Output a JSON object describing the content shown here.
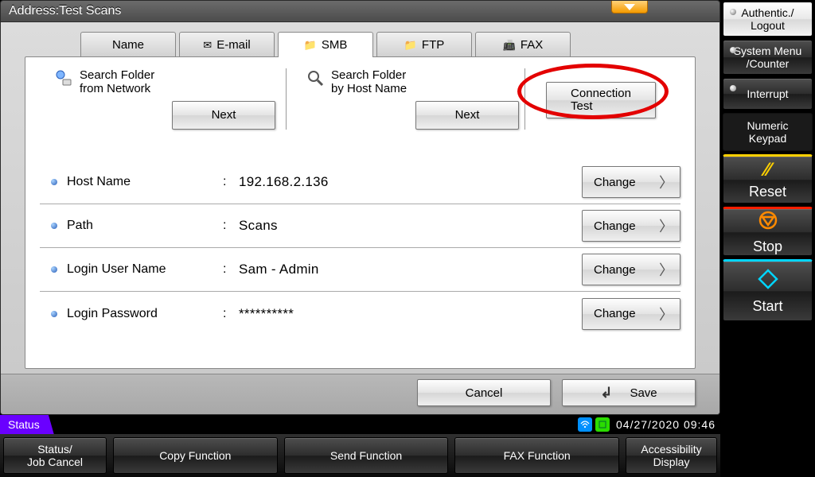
{
  "titlebar": {
    "text": "Address:Test Scans"
  },
  "tabs": [
    {
      "label": "Name"
    },
    {
      "label": "E-mail"
    },
    {
      "label": "SMB"
    },
    {
      "label": "FTP"
    },
    {
      "label": "FAX"
    }
  ],
  "search": {
    "network_label": "Search Folder\nfrom Network",
    "host_label": "Search Folder\nby Host Name",
    "next_label": "Next",
    "connection_test_label": "Connection\nTest"
  },
  "fields": {
    "host_name": {
      "label": "Host Name",
      "value": "192.168.2.136"
    },
    "path": {
      "label": "Path",
      "value": "Scans"
    },
    "login_user": {
      "label": "Login User Name",
      "value": "Sam - Admin"
    },
    "login_pass": {
      "label": "Login Password",
      "value": "**********"
    },
    "change_label": "Change"
  },
  "footer": {
    "cancel": "Cancel",
    "save": "Save"
  },
  "status": {
    "label": "Status",
    "datetime": "04/27/2020  09:46"
  },
  "funcbar": {
    "status_job": "Status/\nJob Cancel",
    "copy": "Copy Function",
    "send": "Send Function",
    "fax": "FAX Function",
    "accessibility": "Accessibility\nDisplay"
  },
  "right": {
    "auth": "Authentic./\nLogout",
    "system": "System Menu\n/Counter",
    "interrupt": "Interrupt",
    "keypad": "Numeric\nKeypad",
    "reset": "Reset",
    "stop": "Stop",
    "start": "Start"
  }
}
